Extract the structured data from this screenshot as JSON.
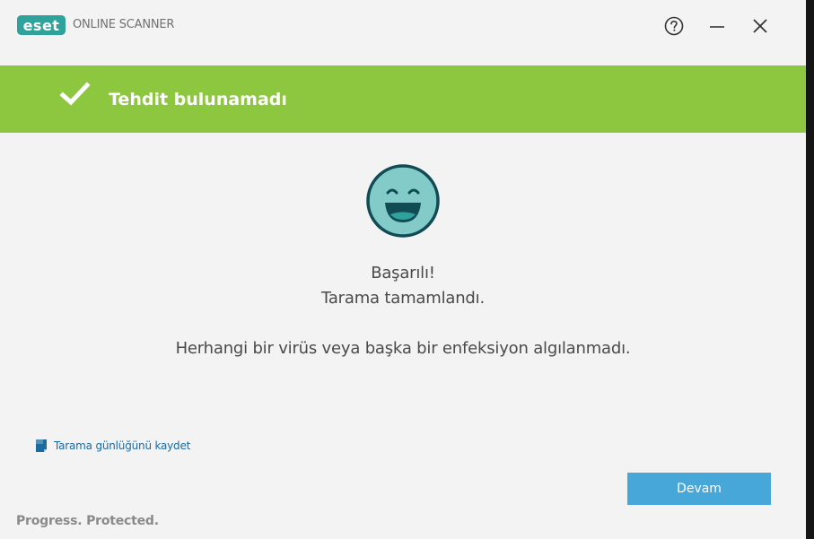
{
  "titlebar": {
    "logo_text": "eset",
    "app_title": "ONLINE SCANNER",
    "help_icon": "help-circle-icon",
    "minimize_icon": "minimize-icon",
    "close_icon": "close-icon"
  },
  "banner": {
    "title": "Tehdit bulunamadı",
    "icon": "check-icon",
    "color": "#8dc63f"
  },
  "result": {
    "icon": "smiley-face-icon",
    "line1": "Başarılı!",
    "line2": "Tarama tamamlandı.",
    "line3": "Herhangi bir virüs veya başka bir enfeksiyon algılanmadı."
  },
  "actions": {
    "save_log_label": "Tarama günlüğünü kaydet",
    "save_log_icon": "save-document-icon",
    "continue_label": "Devam"
  },
  "footer": {
    "tagline": "Progress. Protected."
  },
  "colors": {
    "accent_green": "#8dc63f",
    "button_blue": "#48a7d9",
    "link_blue": "#1c6ba0",
    "logo_teal": "#2fa39b",
    "smiley_fill": "#82cbc9",
    "smiley_outline": "#114b54"
  }
}
